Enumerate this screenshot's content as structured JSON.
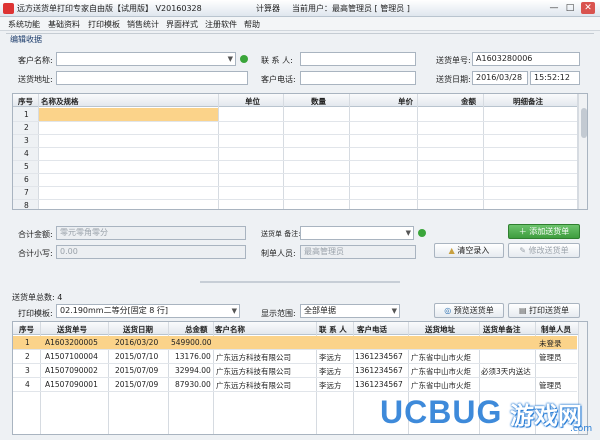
{
  "window": {
    "app_title": "远方送货单打印专家自由版【试用版】 V20160328",
    "calculator": "计算器",
    "current_user": "当前用户：最高管理员 [ 管理员 ]",
    "minimize": "—",
    "maximize": "□",
    "close": "✕"
  },
  "menu": [
    "系统功能",
    "基础资料",
    "打印模板",
    "销售统计",
    "界面样式",
    "注册软件",
    "帮助"
  ],
  "edit": {
    "group_label": "编辑收据",
    "customer_name_label": "客户名称:",
    "customer_name_value": "",
    "contact_label": "联 系 人:",
    "contact_value": "",
    "order_no_label": "送货单号:",
    "order_no_value": "A1603280006",
    "address_label": "送货地址:",
    "address_value": "",
    "phone_label": "客户电话:",
    "phone_value": "",
    "date_label": "送货日期:",
    "date_value": "2016/03/28",
    "time_value": "15:52:12"
  },
  "items_grid": {
    "headers": [
      "序号",
      "名称及规格",
      "单位",
      "数量",
      "单价",
      "金额",
      "明细备注"
    ],
    "rows": [
      "1",
      "2",
      "3",
      "4",
      "5",
      "6",
      "7",
      "8"
    ]
  },
  "totals": {
    "amount_label": "合计金额:",
    "amount_value": "零元零角零分",
    "lower_label": "合计小写:",
    "lower_value": "0.00",
    "note_label": "送货单 备注:",
    "note_value": "",
    "maker_label": "制单人员:",
    "maker_value": "最高管理员",
    "add_button": "添加送货单",
    "clear_button": "清空录入",
    "edit_button": "修改送货单"
  },
  "list": {
    "count_label": "送货单总数: 4",
    "template_label": "打印模板:",
    "template_value": "02.190mm二等分[固定 8 行]",
    "range_label": "显示范围:",
    "range_value": "全部单据",
    "preview_button": "预览送货单",
    "print_button": "打印送货单",
    "headers": [
      "序号",
      "送货单号",
      "送货日期",
      "总金额",
      "客户名称",
      "联 系 人",
      "客户电话",
      "送货地址",
      "送货单备注",
      "制单人员"
    ],
    "rows": [
      [
        "1",
        "A1603200005",
        "2016/03/20",
        "549900.00",
        "",
        "",
        "",
        "",
        "",
        "未登录"
      ],
      [
        "2",
        "A1507100004",
        "2015/07/10",
        "13176.00",
        "广东远方科技有限公司",
        "李远方",
        "1361234567",
        "广东省中山市火炬",
        "",
        "管理员"
      ],
      [
        "3",
        "A1507090002",
        "2015/07/09",
        "32994.00",
        "广东远方科技有限公司",
        "李远方",
        "1361234567",
        "广东省中山市火炬",
        "必须3天内送达",
        ""
      ],
      [
        "4",
        "A1507090001",
        "2015/07/09",
        "87930.00",
        "广东远方科技有限公司",
        "李远方",
        "1361234567",
        "广东省中山市火炬",
        "",
        "管理员"
      ]
    ]
  },
  "watermark": {
    "brand": "UCBUG",
    "cn": "游戏网",
    "domain": ".com"
  },
  "colors": {
    "selected_row": "#fbd38a",
    "accent_green": "#3e9d3e",
    "header_blue": "#1a3a6a"
  }
}
